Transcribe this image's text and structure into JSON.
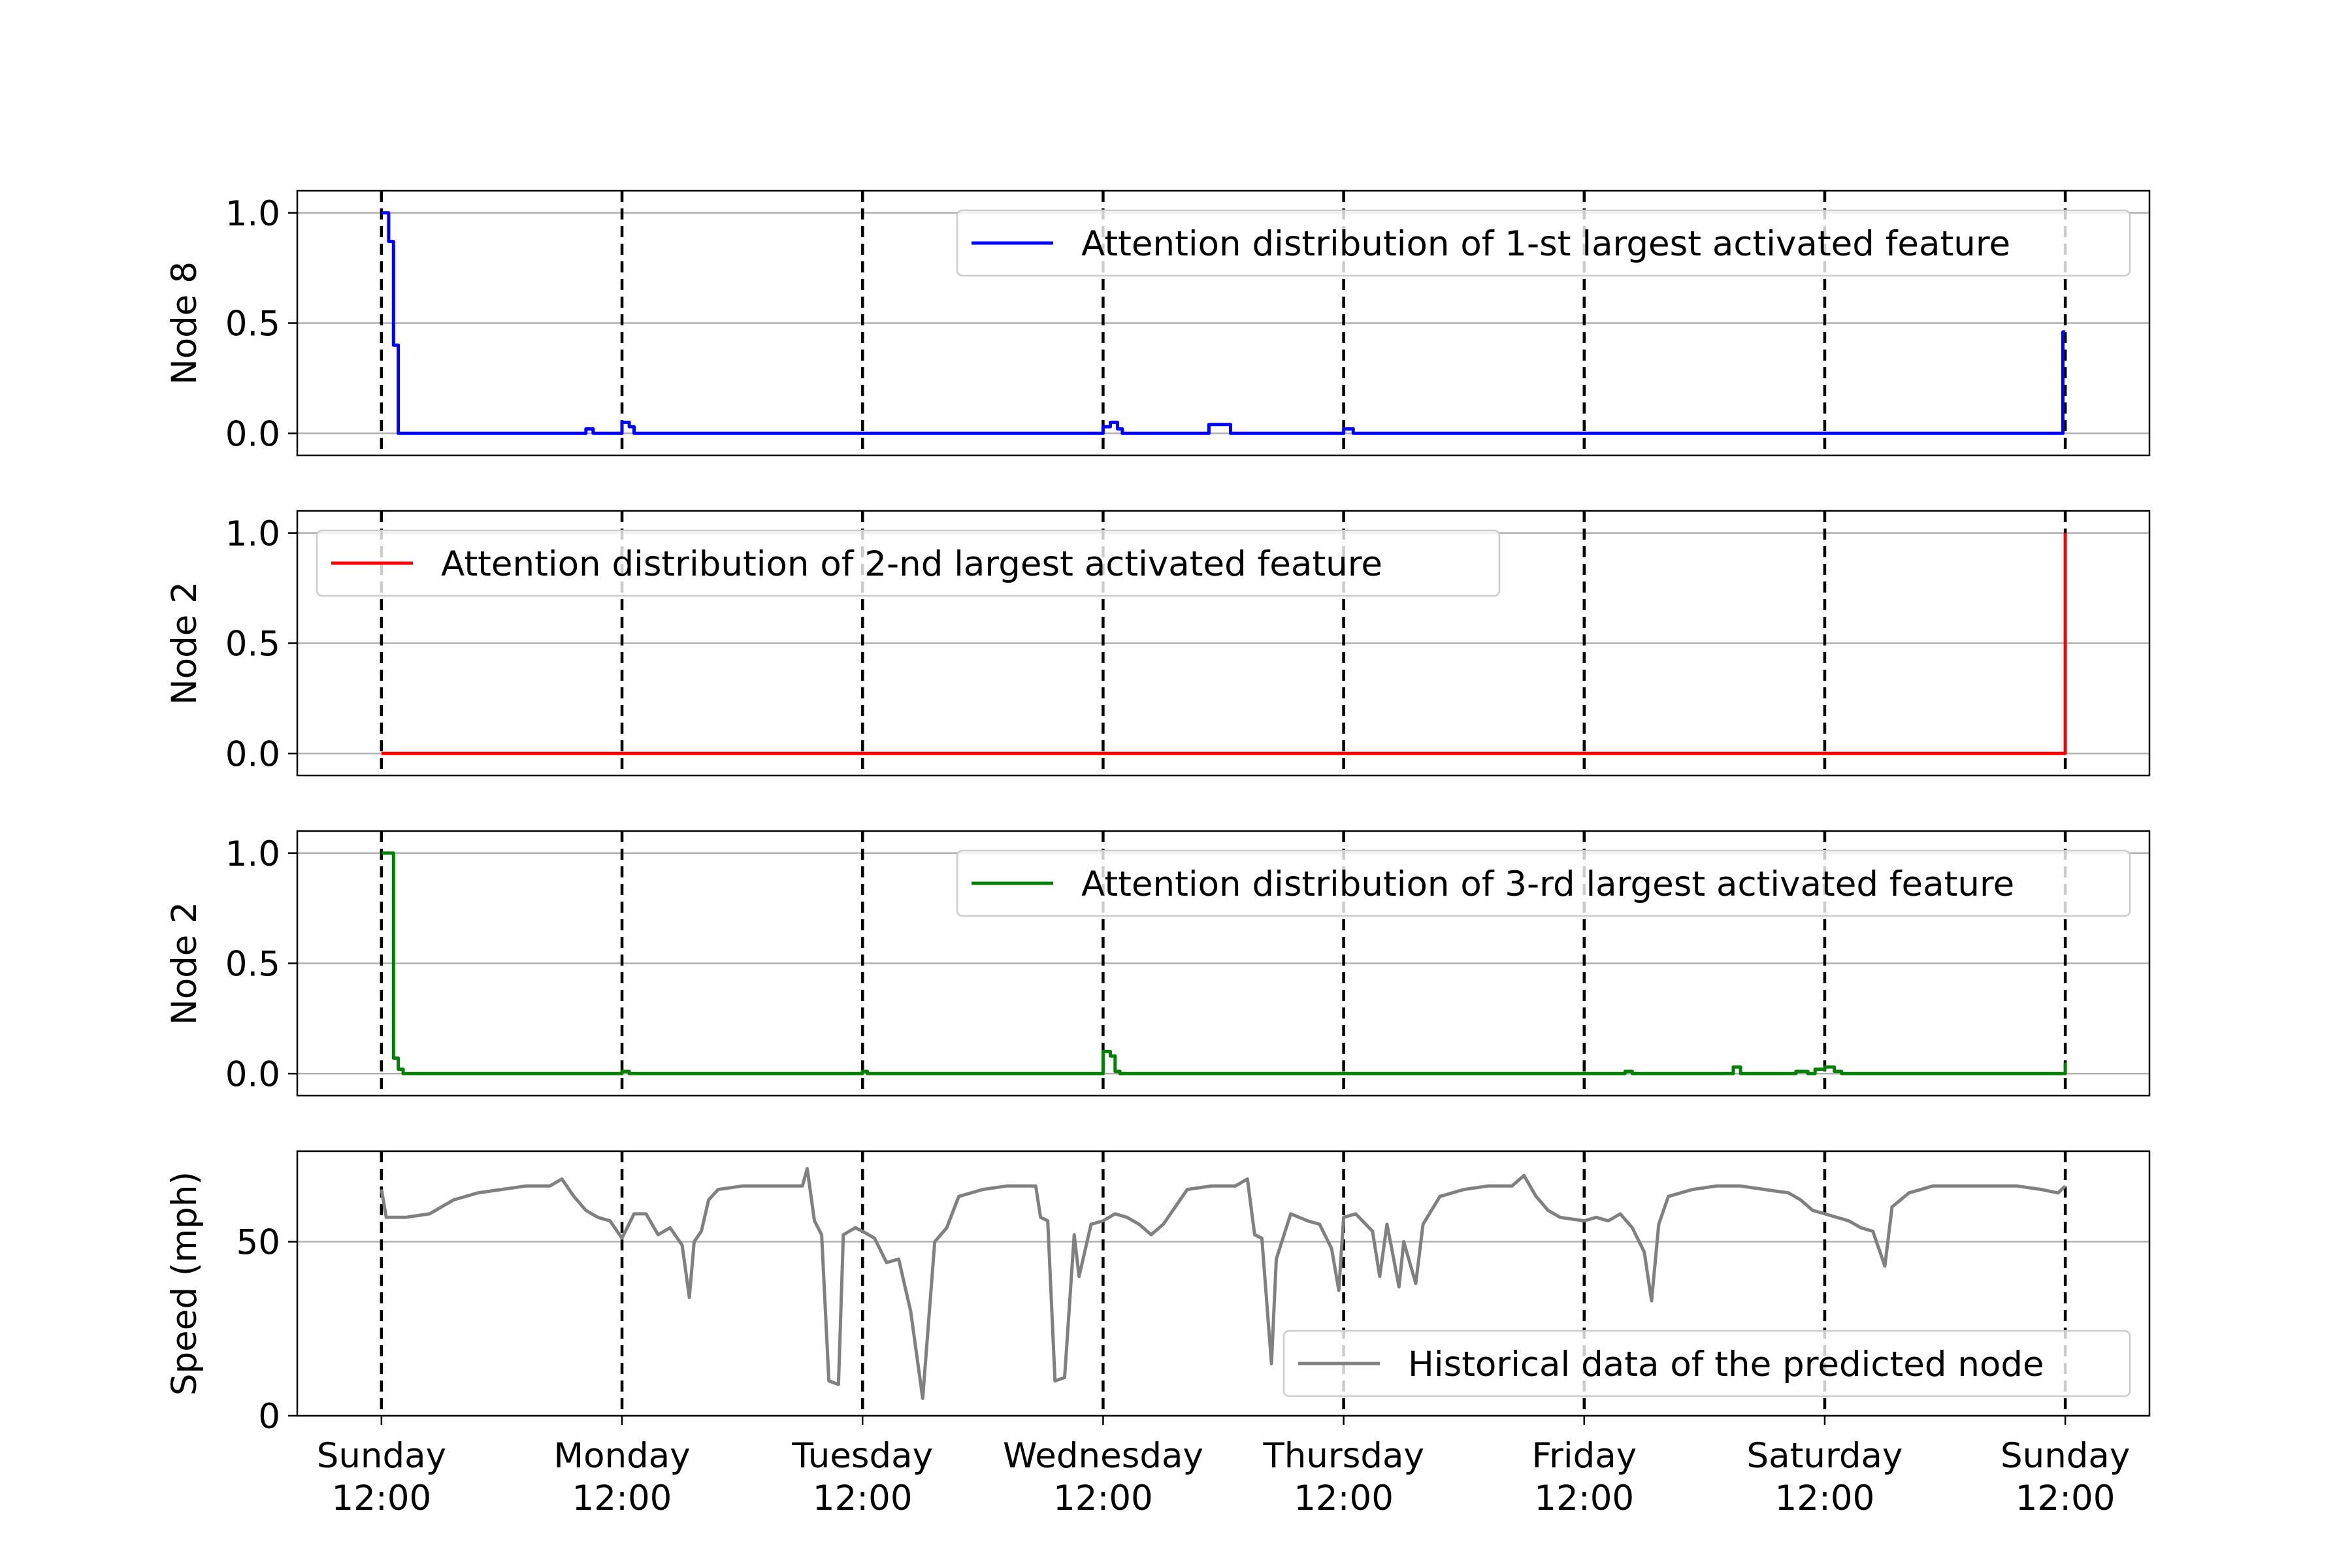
{
  "chart_data": {
    "type": "line",
    "x_tick_labels": [
      [
        "Sunday",
        "12:00"
      ],
      [
        "Monday",
        "12:00"
      ],
      [
        "Tuesday",
        "12:00"
      ],
      [
        "Wednesday",
        "12:00"
      ],
      [
        "Thursday",
        "12:00"
      ],
      [
        "Friday",
        "12:00"
      ],
      [
        "Saturday",
        "12:00"
      ],
      [
        "Sunday",
        "12:00"
      ]
    ],
    "x_unit": "days from first Sunday 12:00",
    "xlim": [
      -0.35,
      7.35
    ],
    "vertical_dashed_lines_at": [
      0,
      1,
      2,
      3,
      4,
      5,
      6,
      7
    ],
    "grid": "horizontal",
    "panels": [
      {
        "ylabel": "Node 8",
        "ylim": [
          -0.1,
          1.1
        ],
        "yticks": [
          0.0,
          0.5,
          1.0
        ],
        "ytick_labels": [
          "0.0",
          "0.5",
          "1.0"
        ],
        "legend_placement": "top-right",
        "series": [
          {
            "name": "Attention distribution of 1-st largest activated feature",
            "color": "#0000ff",
            "points": [
              [
                0,
                1.0
              ],
              [
                0.02,
                1.0
              ],
              [
                0.03,
                0.87
              ],
              [
                0.05,
                0.4
              ],
              [
                0.07,
                0.0
              ],
              [
                0.83,
                0.0
              ],
              [
                0.85,
                0.02
              ],
              [
                0.88,
                0.0
              ],
              [
                0.99,
                0.0
              ],
              [
                1.0,
                0.05
              ],
              [
                1.03,
                0.03
              ],
              [
                1.05,
                0.0
              ],
              [
                2.99,
                0.0
              ],
              [
                3.0,
                0.03
              ],
              [
                3.03,
                0.05
              ],
              [
                3.06,
                0.02
              ],
              [
                3.08,
                0.0
              ],
              [
                3.42,
                0.0
              ],
              [
                3.44,
                0.04
              ],
              [
                3.5,
                0.04
              ],
              [
                3.53,
                0.0
              ],
              [
                3.99,
                0.0
              ],
              [
                4.0,
                0.02
              ],
              [
                4.04,
                0.0
              ],
              [
                6.98,
                0.0
              ],
              [
                6.99,
                0.46
              ],
              [
                7.0,
                0.46
              ]
            ]
          }
        ]
      },
      {
        "ylabel": "Node 2",
        "ylim": [
          -0.1,
          1.1
        ],
        "yticks": [
          0.0,
          0.5,
          1.0
        ],
        "ytick_labels": [
          "0.0",
          "0.5",
          "1.0"
        ],
        "legend_placement": "top-left",
        "series": [
          {
            "name": "Attention distribution of 2-nd largest activated feature",
            "color": "#ff0000",
            "points": [
              [
                0,
                0.0
              ],
              [
                6.995,
                0.0
              ],
              [
                7.0,
                1.0
              ]
            ]
          }
        ]
      },
      {
        "ylabel": "Node 2",
        "ylim": [
          -0.1,
          1.1
        ],
        "yticks": [
          0.0,
          0.5,
          1.0
        ],
        "ytick_labels": [
          "0.0",
          "0.5",
          "1.0"
        ],
        "legend_placement": "top-right",
        "series": [
          {
            "name": "Attention distribution of 3-rd largest activated feature",
            "color": "#008000",
            "points": [
              [
                0,
                1.0
              ],
              [
                0.04,
                1.0
              ],
              [
                0.05,
                0.07
              ],
              [
                0.07,
                0.02
              ],
              [
                0.09,
                0.0
              ],
              [
                1.0,
                0.01
              ],
              [
                1.03,
                0.0
              ],
              [
                2.0,
                0.01
              ],
              [
                2.02,
                0.0
              ],
              [
                2.98,
                0.0
              ],
              [
                3.0,
                0.1
              ],
              [
                3.03,
                0.08
              ],
              [
                3.05,
                0.01
              ],
              [
                3.07,
                0.0
              ],
              [
                5.15,
                0.0
              ],
              [
                5.17,
                0.01
              ],
              [
                5.2,
                0.0
              ],
              [
                5.6,
                0.0
              ],
              [
                5.62,
                0.03
              ],
              [
                5.65,
                0.0
              ],
              [
                5.86,
                0.0
              ],
              [
                5.88,
                0.01
              ],
              [
                5.93,
                0.0
              ],
              [
                5.96,
                0.02
              ],
              [
                6.0,
                0.03
              ],
              [
                6.04,
                0.01
              ],
              [
                6.07,
                0.0
              ],
              [
                6.98,
                0.0
              ],
              [
                7.0,
                0.05
              ]
            ]
          }
        ]
      },
      {
        "ylabel": "Speed (mph)",
        "ylim": [
          0,
          76
        ],
        "yticks": [
          0,
          50
        ],
        "ytick_labels": [
          "0",
          "50"
        ],
        "legend_placement": "bottom-right",
        "series": [
          {
            "name": "Historical data of the predicted node",
            "color": "#808080",
            "points": [
              [
                0,
                65
              ],
              [
                0.02,
                57
              ],
              [
                0.1,
                57
              ],
              [
                0.2,
                58
              ],
              [
                0.3,
                62
              ],
              [
                0.4,
                64
              ],
              [
                0.5,
                65
              ],
              [
                0.6,
                66
              ],
              [
                0.7,
                66
              ],
              [
                0.75,
                68
              ],
              [
                0.8,
                63
              ],
              [
                0.85,
                59
              ],
              [
                0.9,
                57
              ],
              [
                0.95,
                56
              ],
              [
                1.0,
                51
              ],
              [
                1.05,
                58
              ],
              [
                1.1,
                58
              ],
              [
                1.15,
                52
              ],
              [
                1.2,
                54
              ],
              [
                1.25,
                49
              ],
              [
                1.28,
                34
              ],
              [
                1.3,
                50
              ],
              [
                1.33,
                53
              ],
              [
                1.36,
                62
              ],
              [
                1.4,
                65
              ],
              [
                1.5,
                66
              ],
              [
                1.6,
                66
              ],
              [
                1.75,
                66
              ],
              [
                1.77,
                71
              ],
              [
                1.8,
                56
              ],
              [
                1.83,
                52
              ],
              [
                1.86,
                10
              ],
              [
                1.9,
                9
              ],
              [
                1.92,
                52
              ],
              [
                1.97,
                54
              ],
              [
                2.0,
                53
              ],
              [
                2.05,
                51
              ],
              [
                2.1,
                44
              ],
              [
                2.15,
                45
              ],
              [
                2.2,
                30
              ],
              [
                2.25,
                5
              ],
              [
                2.3,
                50
              ],
              [
                2.35,
                54
              ],
              [
                2.4,
                63
              ],
              [
                2.5,
                65
              ],
              [
                2.6,
                66
              ],
              [
                2.72,
                66
              ],
              [
                2.74,
                57
              ],
              [
                2.77,
                56
              ],
              [
                2.8,
                10
              ],
              [
                2.84,
                11
              ],
              [
                2.88,
                52
              ],
              [
                2.9,
                40
              ],
              [
                2.95,
                55
              ],
              [
                3.0,
                56
              ],
              [
                3.05,
                58
              ],
              [
                3.1,
                57
              ],
              [
                3.15,
                55
              ],
              [
                3.2,
                52
              ],
              [
                3.25,
                55
              ],
              [
                3.3,
                60
              ],
              [
                3.35,
                65
              ],
              [
                3.45,
                66
              ],
              [
                3.55,
                66
              ],
              [
                3.6,
                68
              ],
              [
                3.63,
                52
              ],
              [
                3.66,
                51
              ],
              [
                3.7,
                15
              ],
              [
                3.72,
                45
              ],
              [
                3.78,
                58
              ],
              [
                3.85,
                56
              ],
              [
                3.9,
                55
              ],
              [
                3.95,
                48
              ],
              [
                3.98,
                36
              ],
              [
                4.0,
                57
              ],
              [
                4.05,
                58
              ],
              [
                4.12,
                53
              ],
              [
                4.15,
                40
              ],
              [
                4.18,
                55
              ],
              [
                4.2,
                48
              ],
              [
                4.23,
                37
              ],
              [
                4.25,
                50
              ],
              [
                4.3,
                38
              ],
              [
                4.33,
                55
              ],
              [
                4.4,
                63
              ],
              [
                4.5,
                65
              ],
              [
                4.6,
                66
              ],
              [
                4.7,
                66
              ],
              [
                4.75,
                69
              ],
              [
                4.8,
                63
              ],
              [
                4.85,
                59
              ],
              [
                4.9,
                57
              ],
              [
                5.0,
                56
              ],
              [
                5.05,
                57
              ],
              [
                5.1,
                56
              ],
              [
                5.15,
                58
              ],
              [
                5.2,
                54
              ],
              [
                5.25,
                47
              ],
              [
                5.28,
                33
              ],
              [
                5.31,
                55
              ],
              [
                5.35,
                63
              ],
              [
                5.45,
                65
              ],
              [
                5.55,
                66
              ],
              [
                5.65,
                66
              ],
              [
                5.75,
                65
              ],
              [
                5.85,
                64
              ],
              [
                5.9,
                62
              ],
              [
                5.95,
                59
              ],
              [
                6.0,
                58
              ],
              [
                6.1,
                56
              ],
              [
                6.15,
                54
              ],
              [
                6.2,
                53
              ],
              [
                6.25,
                43
              ],
              [
                6.28,
                60
              ],
              [
                6.35,
                64
              ],
              [
                6.45,
                66
              ],
              [
                6.55,
                66
              ],
              [
                6.7,
                66
              ],
              [
                6.8,
                66
              ],
              [
                6.9,
                65
              ],
              [
                6.97,
                64
              ],
              [
                7.0,
                66
              ]
            ]
          }
        ]
      }
    ]
  }
}
